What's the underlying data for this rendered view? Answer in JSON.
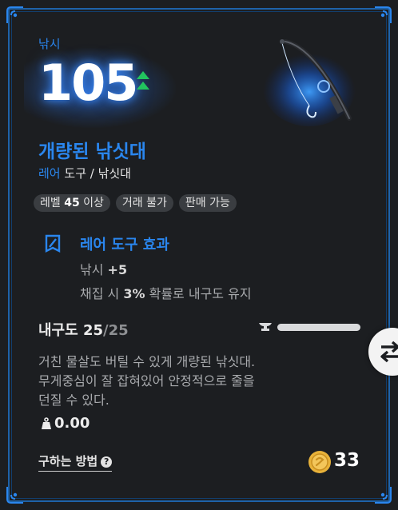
{
  "stat": {
    "category": "낚시",
    "value": "105"
  },
  "item": {
    "name": "개량된 낚싯대",
    "rarity": "레어",
    "type": "도구 / 낚싯대"
  },
  "tags": {
    "level_prefix": "레벨",
    "level_value": "45",
    "level_suffix": "이상",
    "trade": "거래 불가",
    "sell": "판매 가능"
  },
  "effect": {
    "title": "레어 도구 효과",
    "stat_name": "낚시",
    "stat_bonus": "+5",
    "line2_prefix": "채집 시",
    "line2_value": "3%",
    "line2_suffix": "확률로 내구도 유지"
  },
  "durability": {
    "label": "내구도",
    "current": "25",
    "max": "/25",
    "fraction": 1.0
  },
  "description": "거친 물살도 버틸 수 있게 개량된 낚싯대.\n무게중심이 잘 잡혀있어 안정적으로 줄을\n던질 수 있다.",
  "weight": "0.00",
  "footer": {
    "how_to_get": "구하는 방법",
    "price": "33"
  },
  "colors": {
    "accent": "#2a86ee",
    "frame": "#1e62a9",
    "background": "#1c1e21",
    "up_arrow": "#22c55e",
    "coin": "#e8b23a"
  },
  "icons": {
    "rarity_icon": "rare-tool-icon",
    "durability_icon": "anvil-icon",
    "weight_icon": "weight-icon",
    "swap_icon": "swap-arrows-icon",
    "coin_icon": "gold-coin-icon"
  }
}
